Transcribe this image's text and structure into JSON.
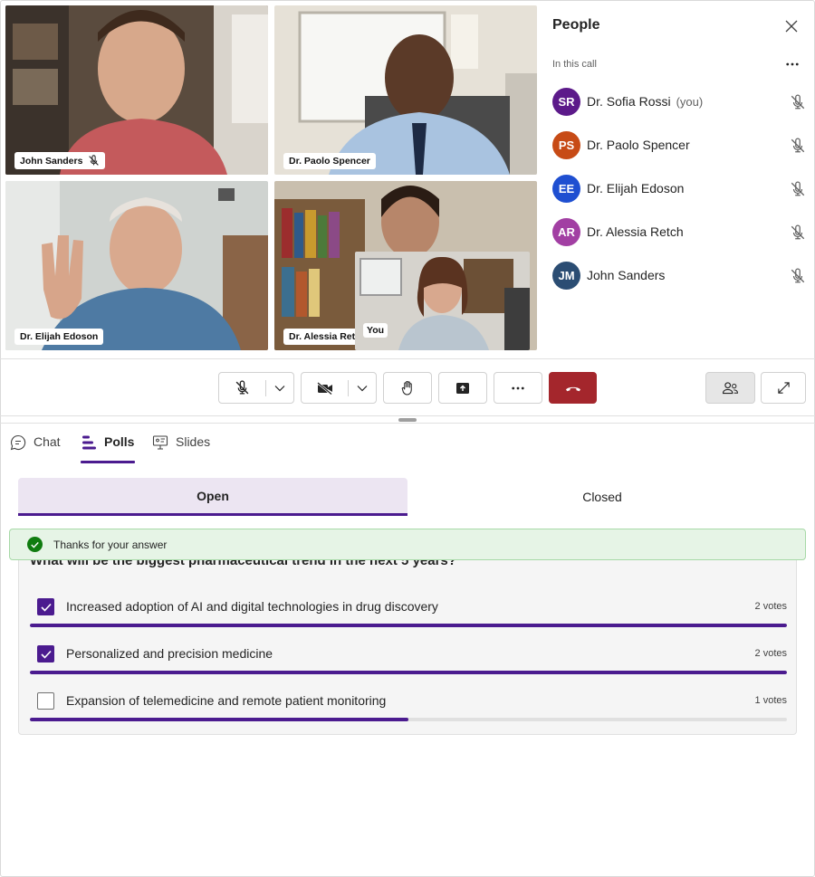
{
  "participants_video": [
    {
      "name": "John Sanders",
      "muted": true
    },
    {
      "name": "Dr. Paolo Spencer",
      "muted": false
    },
    {
      "name": "Dr. Elijah Edoson",
      "muted": false
    },
    {
      "name": "Dr. Alessia Retch",
      "muted": false
    },
    {
      "name": "You",
      "muted": false
    }
  ],
  "people_panel": {
    "title": "People",
    "section_label": "In this call",
    "you_suffix": "(you)",
    "people": [
      {
        "initials": "SR",
        "name": "Dr. Sofia Rossi",
        "color": "#5c1a8a",
        "is_you": true
      },
      {
        "initials": "PS",
        "name": "Dr. Paolo Spencer",
        "color": "#c74b16"
      },
      {
        "initials": "EE",
        "name": "Dr. Elijah Edoson",
        "color": "#1f4fd1"
      },
      {
        "initials": "AR",
        "name": "Dr. Alessia Retch",
        "color": "#a23fa3"
      },
      {
        "initials": "JM",
        "name": "John Sanders",
        "color": "#2b4d73"
      }
    ]
  },
  "toolbar": {
    "icons": [
      "mic-off-icon",
      "chevron-down-icon",
      "video-off-icon",
      "chevron-down-icon",
      "raise-hand-icon",
      "share-screen-icon",
      "more-icon",
      "hang-up-icon",
      "people-icon",
      "expand-icon"
    ],
    "hangup_color": "#a4262c"
  },
  "tabs": [
    {
      "label": "Chat",
      "icon": "chat-icon",
      "active": false
    },
    {
      "label": "Polls",
      "icon": "polls-icon",
      "active": true
    },
    {
      "label": "Slides",
      "icon": "slides-icon",
      "active": false
    }
  ],
  "poll_filter": {
    "open_label": "Open",
    "closed_label": "Closed",
    "selected": "Open"
  },
  "toast": {
    "message": "Thanks for your answer",
    "color": "#107c10"
  },
  "poll": {
    "question": "What will be the biggest pharmaceutical trend in the next 5 years?",
    "options": [
      {
        "text": "Increased adoption of AI and digital technologies in drug discovery",
        "votes_label": "2 votes",
        "votes": 2,
        "checked": true,
        "fraction": 1.0
      },
      {
        "text": "Personalized and precision medicine",
        "votes_label": "2 votes",
        "votes": 2,
        "checked": true,
        "fraction": 1.0
      },
      {
        "text": "Expansion of telemedicine and remote patient monitoring",
        "votes_label": "1 votes",
        "votes": 1,
        "checked": false,
        "fraction": 0.5
      }
    ]
  },
  "accent_color": "#4b1b8f"
}
